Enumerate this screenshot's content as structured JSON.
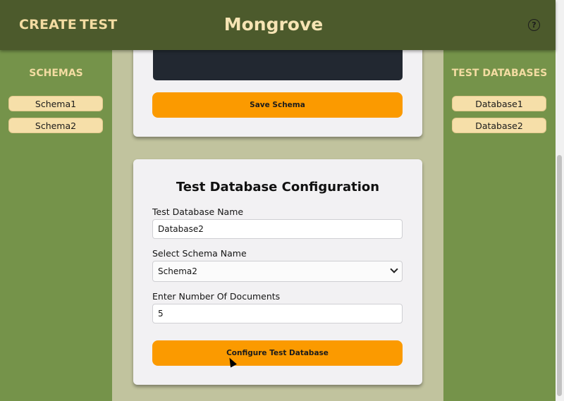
{
  "header": {
    "nav": {
      "create": "CREATE",
      "test": "TEST"
    },
    "brand": "Mongrove",
    "help_icon": "?"
  },
  "schemas_sidebar": {
    "title": "SCHEMAS",
    "items": [
      "Schema1",
      "Schema2"
    ]
  },
  "databases_sidebar": {
    "title": "TEST DATABASES",
    "items": [
      "Database1",
      "Database2"
    ]
  },
  "schema_card": {
    "save_label": "Save Schema"
  },
  "config_card": {
    "title": "Test Database Configuration",
    "db_name_label": "Test Database Name",
    "db_name_value": "Database2",
    "schema_label": "Select Schema Name",
    "schema_value": "Schema2",
    "docs_label": "Enter Number Of Documents",
    "docs_value": "5",
    "configure_label": "Configure Test Database"
  },
  "colors": {
    "header": "#4c5a2c",
    "sidebar": "#75934a",
    "accent_text": "#f3dca2",
    "button": "#fb9a00",
    "pill": "#f6dfa9"
  }
}
